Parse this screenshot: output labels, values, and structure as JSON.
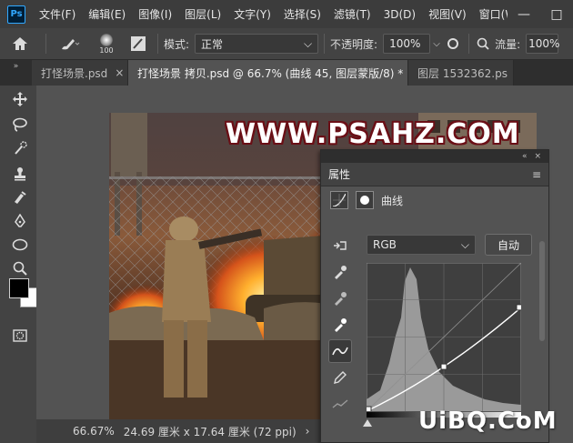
{
  "menubar": {
    "logo": "Ps",
    "items": [
      "文件(F)",
      "编辑(E)",
      "图像(I)",
      "图层(L)",
      "文字(Y)",
      "选择(S)",
      "滤镜(T)",
      "3D(D)",
      "视图(V)",
      "窗口(W"
    ],
    "minimize": "—",
    "restore": "□"
  },
  "optbar": {
    "brush_size": "100",
    "mode_label": "模式:",
    "mode_value": "正常",
    "opacity_label": "不透明度:",
    "opacity_value": "100%",
    "flow_label": "流量:",
    "flow_value": "100%"
  },
  "tabs": [
    {
      "label": "打怪场景.psd",
      "close": "×",
      "active": false
    },
    {
      "label": "打怪场景 拷贝.psd @ 66.7% (曲线 45, 图层蒙版/8) *",
      "close": "×",
      "active": true
    },
    {
      "label": "图层 1532362.ps",
      "close": "×",
      "active": false
    }
  ],
  "canvas": {
    "title_text": "WWW.PSAHZ.COM"
  },
  "status": {
    "zoom": "66.67%",
    "dimensions": "24.69 厘米 x 17.64 厘米 (72 ppi)",
    "arrow": "›"
  },
  "panel": {
    "tab_label": "属性",
    "adjustment_name": "曲线",
    "channel": "RGB",
    "auto_label": "自动",
    "curve_points": [
      [
        0,
        0
      ],
      [
        0.5,
        0.3
      ],
      [
        1,
        0.7
      ]
    ]
  },
  "watermark": "UiBQ.CoM",
  "colors": {
    "foreground": "#000000",
    "background": "#ffffff",
    "title_stroke": "#6a0f16"
  }
}
